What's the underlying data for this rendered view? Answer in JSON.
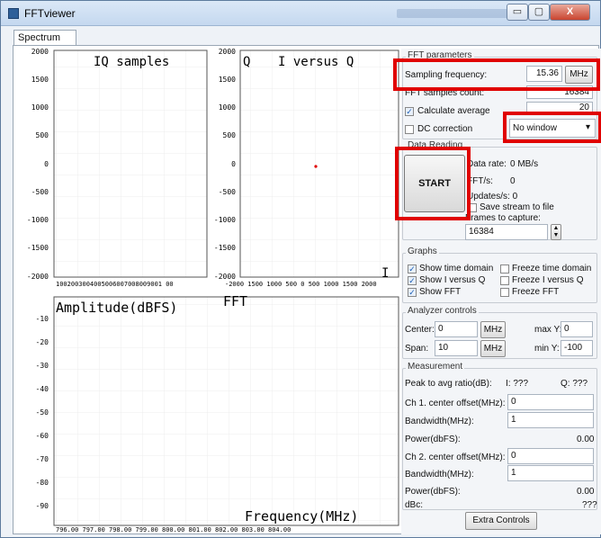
{
  "window": {
    "title": "FFTviewer",
    "minimize": "▭",
    "maximize": "▢",
    "close": "X"
  },
  "tab": {
    "label": "Spectrum"
  },
  "plots": {
    "iq_title": "IQ samples",
    "iq_yticks": [
      "2000",
      "1500",
      "1000",
      "500",
      "0",
      "-500",
      "-1000",
      "-1500",
      "-2000"
    ],
    "iq_xticks": "1002003004005006007008009001 00",
    "ivq_title_a": "Q",
    "ivq_title_b": "I versus Q",
    "ivq_yticks": [
      "2000",
      "1500",
      "1000",
      "500",
      "0",
      "-500",
      "-1000",
      "-1500",
      "-2000"
    ],
    "ivq_xticks": "-2000 1500 1000 500 0 500 1000 1500 2000",
    "ivq_x_axis_letter": "I",
    "fft_ylabel": "Amplitude(dBFS)",
    "fft_title": "FFT",
    "fft_yticks": [
      "-10",
      "-20",
      "-30",
      "-40",
      "-50",
      "-60",
      "-70",
      "-80",
      "-90"
    ],
    "fft_xlabel": "Frequency(MHz)",
    "fft_xticks": "796.00 797.00 798.00 799.00 800.00 801.00 802.00 803.00 804.00"
  },
  "fft_params": {
    "title": "FFT parameters",
    "sampling_frequency_label": "Sampling frequency:",
    "sampling_frequency_value": "15.36",
    "sampling_frequency_unit": "MHz",
    "samples_count_label": "FFT samples count:",
    "samples_count_value": "16384",
    "calc_avg_label": "Calculate average",
    "calc_avg_value": "20",
    "dc_correction_label": "DC correction",
    "window_select": "No window",
    "window_arrow": "▾"
  },
  "data_reading": {
    "title": "Data Reading",
    "start_label": "START",
    "data_rate_label": "Data rate:",
    "data_rate_value": "0 MB/s",
    "fft_per_s_label": "FFT/s:",
    "fft_per_s_value": "0",
    "updates_label": "Updates/s: 0",
    "save_stream_label": "Save stream to file",
    "frames_label": "Frames to capture:",
    "frames_value": "16384"
  },
  "graphs": {
    "title": "Graphs",
    "show_time_domain": "Show time domain",
    "freeze_time_domain": "Freeze time domain",
    "show_ivq": "Show I versus Q",
    "freeze_ivq": "Freeze I versus Q",
    "show_fft": "Show FFT",
    "freeze_fft": "Freeze FFT"
  },
  "analyzer": {
    "title": "Analyzer controls",
    "center_label": "Center:",
    "center_value": "0",
    "center_unit": "MHz",
    "maxy_label": "max Y:",
    "maxy_value": "0",
    "span_label": "Span:",
    "span_value": "10",
    "span_unit": "MHz",
    "miny_label": "min Y:",
    "miny_value": "-100"
  },
  "measurement": {
    "title": "Measurement",
    "peak_label": "Peak to avg ratio(dB):",
    "peak_i": "I: ???",
    "peak_q": "Q: ???",
    "ch1_offset_label": "Ch 1. center offset(MHz):",
    "ch1_offset_value": "0",
    "ch1_bw_label": "Bandwidth(MHz):",
    "ch1_bw_value": "1",
    "ch1_power_label": "Power(dbFS):",
    "ch1_power_value": "0.00",
    "ch2_offset_label": "Ch 2. center offset(MHz):",
    "ch2_offset_value": "0",
    "ch2_bw_label": "Bandwidth(MHz):",
    "ch2_bw_value": "1",
    "ch2_power_label": "Power(dbFS):",
    "ch2_power_value": "0.00",
    "dbc_label": "dBc:",
    "dbc_value": "???"
  },
  "extra_controls_label": "Extra Controls"
}
